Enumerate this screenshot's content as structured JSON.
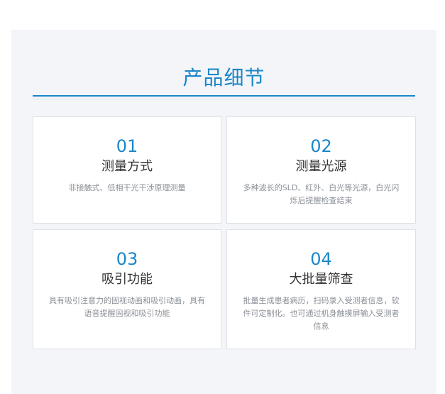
{
  "section": {
    "title": "产品细节"
  },
  "cards": [
    {
      "number": "01",
      "title": "测量方式",
      "description": "非接触式、低相干光干涉原理测量"
    },
    {
      "number": "02",
      "title": "测量光源",
      "description": "多种波长的SLD、红外、白光等光源，白光闪烁后提醒检查结束"
    },
    {
      "number": "03",
      "title": "吸引功能",
      "description": "具有吸引注意力的固视动画和吸引动画，具有语音提醒固视和吸引功能"
    },
    {
      "number": "04",
      "title": "大批量筛查",
      "description": "批量生成患者病历，扫码录入受测者信息，软件可定制化。也可通过机身触摸屏输入受测者信息"
    }
  ],
  "colors": {
    "accent": "#1a86c8",
    "background": "#f3f5f9",
    "card": "#ffffff"
  }
}
